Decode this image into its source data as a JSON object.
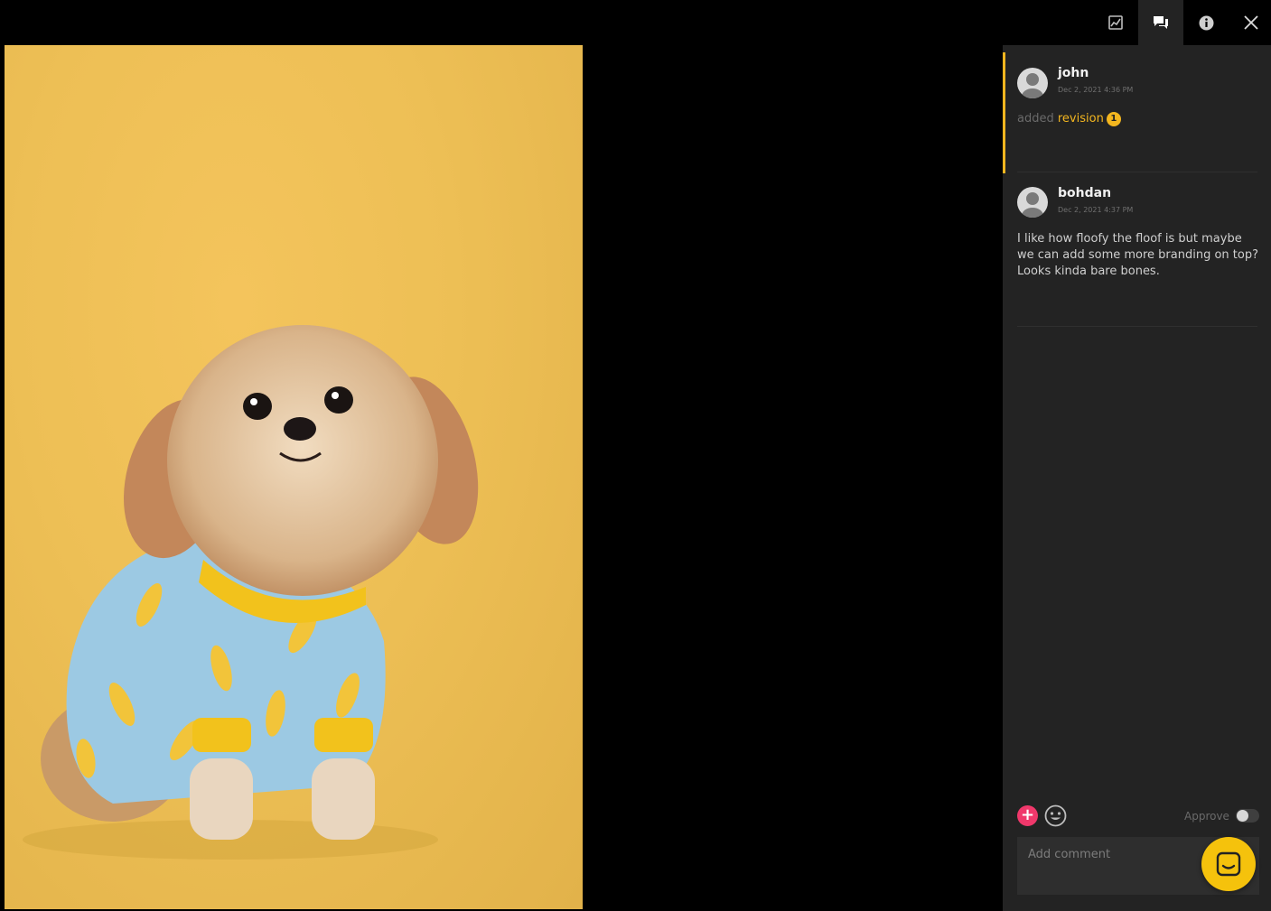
{
  "toolbar": {
    "tools": [
      {
        "icon": "activity-chart-icon",
        "label": "Activity"
      },
      {
        "icon": "comments-icon",
        "label": "Comments",
        "active": true
      },
      {
        "icon": "info-icon",
        "label": "Info"
      },
      {
        "icon": "close-icon",
        "label": "Close"
      }
    ]
  },
  "viewer": {
    "image_description": "small fluffy dog in banana-print blue pajamas on a yellow background"
  },
  "comments": [
    {
      "author": "john",
      "timestamp": "Dec 2, 2021 4:36 PM",
      "type": "activity",
      "action_text": "added",
      "link_text": "revision",
      "revision_badge": "1",
      "highlighted": true
    },
    {
      "author": "bohdan",
      "timestamp": "Dec 2, 2021 4:37 PM",
      "type": "comment",
      "text": "I like how floofy the floof is but maybe we can add some more branding on top? Looks kinda bare bones."
    }
  ],
  "composer": {
    "placeholder": "Add comment",
    "approve_label": "Approve",
    "approve_on": false
  },
  "colors": {
    "accent": "#f3b61f",
    "add_button": "#f0386b",
    "panel_bg": "#232323",
    "chat_launcher": "#f5c20c"
  }
}
